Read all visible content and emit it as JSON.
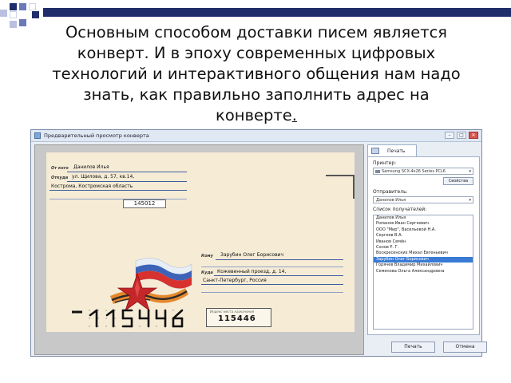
{
  "slide": {
    "caption_lines": [
      "Основным способом доставки писем является",
      "конверт. И в эпоху современных цифровых",
      "технологий и интерактивного общения нам надо",
      "знать, как правильно заполнить адрес на",
      "конверте"
    ],
    "caption_end": "."
  },
  "window": {
    "title": "Предварительный просмотр конверта",
    "min": "–",
    "max": "□",
    "close": "✕"
  },
  "envelope": {
    "sender_name_label": "От кого",
    "sender_name": "Данилов Илья",
    "sender_addr_label": "Откуда",
    "sender_addr": "ул. Щилова, д. 57, кв.14,",
    "sender_city": "Кострома, Костромская область",
    "sender_index": "145012",
    "recipient_name_label": "Кому",
    "recipient_name": "Зарубин Олег Борисович",
    "recipient_addr_label": "Куда",
    "recipient_addr": "Кожевенный проезд, д. 14,",
    "recipient_city": "Санкт-Петербург, Россия",
    "index_label": "Индекс места назначения",
    "index_value": "115446"
  },
  "panel": {
    "tab_label": "Печать",
    "printer_label": "Принтер:",
    "printer_value": "Samsung SCX-4x26 Series PCL6",
    "properties_btn": "Свойства",
    "sender_label": "Отправитель:",
    "sender_value": "Данилов Илья",
    "recipients_label": "Список получателей:",
    "recipients": [
      "Данилов Илья",
      "Романов Иван Сергеевич",
      "ООО \"Мир\", Васильевой Н.А.",
      "Сергеев В.А.",
      "Иванов Семён",
      "Сонов Р. Г.",
      "Воскресенских Михал Евгеньевич",
      "Зарубин Олег Борисович",
      "Горячев Владимир Михайлович",
      "Семенова Ольга Александровна"
    ],
    "selected_index": 7,
    "print_btn": "Печать",
    "cancel_btn": "Отмена"
  }
}
